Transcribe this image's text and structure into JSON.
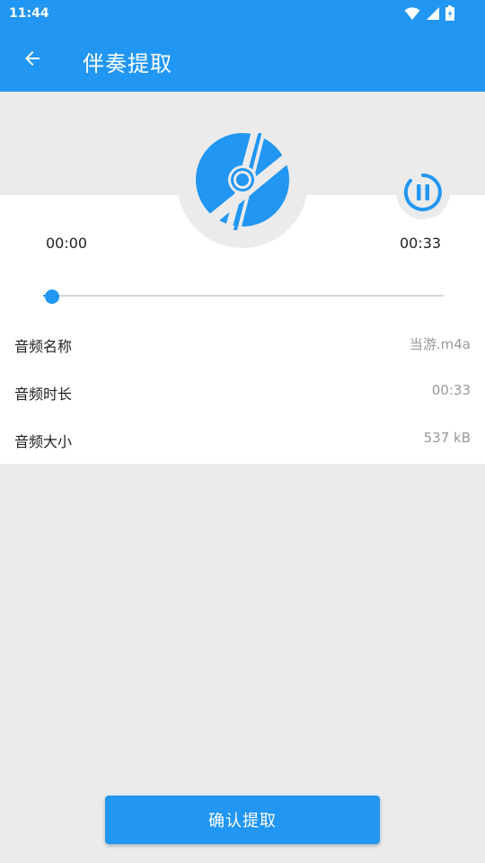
{
  "status_bar": {
    "time": "11:44",
    "icons": [
      "wifi-icon",
      "cell-signal-icon",
      "battery-icon"
    ]
  },
  "app_bar": {
    "title": "伴奏提取",
    "back_icon": "arrow-back-icon"
  },
  "player": {
    "disc_icon": "disc-icon",
    "pause_icon": "pause-icon",
    "time_current": "00:00",
    "time_total": "00:33",
    "progress_fraction": 0.02
  },
  "info": {
    "rows": [
      {
        "label": "音频名称",
        "value": "当游.m4a"
      },
      {
        "label": "音频时长",
        "value": "00:33"
      },
      {
        "label": "音频大小",
        "value": "537 kB"
      }
    ]
  },
  "actions": {
    "confirm_label": "确认提取"
  },
  "colors": {
    "primary": "#2196f3",
    "background": "#ebebeb",
    "panel": "#ffffff"
  }
}
